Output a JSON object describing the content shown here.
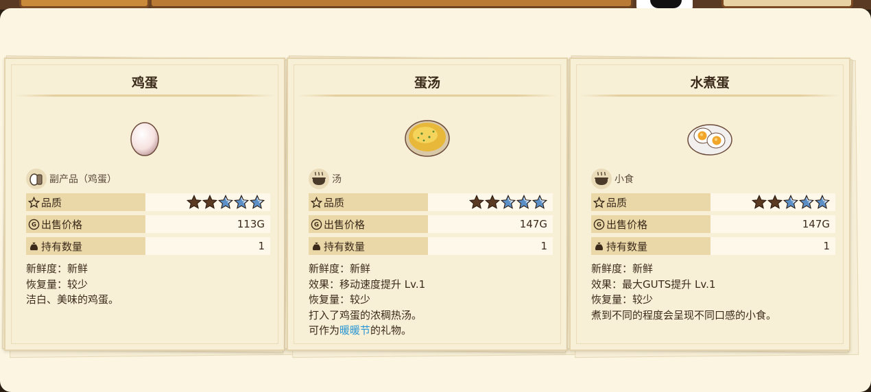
{
  "cards": [
    {
      "title": "鸡蛋",
      "category": "副产品（鸡蛋）",
      "category_icon": "byproduct-icon",
      "item_icon": "egg-icon",
      "quality_label": "品质",
      "quality_stars_filled": 2,
      "quality_stars_total": 5,
      "price_label": "出售价格",
      "price": "113G",
      "owned_label": "持有数量",
      "owned": "1",
      "desc": [
        "新鲜度：新鲜",
        "恢复量：较少",
        "洁白、美味的鸡蛋。"
      ]
    },
    {
      "title": "蛋汤",
      "category": "汤",
      "category_icon": "cooking-pot-icon",
      "item_icon": "egg-soup-icon",
      "quality_label": "品质",
      "quality_stars_filled": 2,
      "quality_stars_total": 5,
      "price_label": "出售价格",
      "price": "147G",
      "owned_label": "持有数量",
      "owned": "1",
      "desc": [
        "新鲜度：新鲜",
        "效果：移动速度提升 Lv.1",
        "恢复量：较少",
        "打入了鸡蛋的浓稠热汤。"
      ],
      "desc_last_prefix": "可作为",
      "desc_last_highlight": "暖暖节",
      "desc_last_suffix": "的礼物。"
    },
    {
      "title": "水煮蛋",
      "category": "小食",
      "category_icon": "cooking-pot-icon",
      "item_icon": "boiled-egg-icon",
      "quality_label": "品质",
      "quality_stars_filled": 2,
      "quality_stars_total": 5,
      "price_label": "出售价格",
      "price": "147G",
      "owned_label": "持有数量",
      "owned": "1",
      "desc": [
        "新鲜度：新鲜",
        "效果：最大GUTS提升 Lv.1",
        "恢复量：较少",
        "煮到不同的程度会呈现不同口感的小食。"
      ]
    }
  ],
  "colors": {
    "filled_star": "#5a3a22",
    "empty_star": "#5b8fc6",
    "highlight": "#2a97d4"
  }
}
